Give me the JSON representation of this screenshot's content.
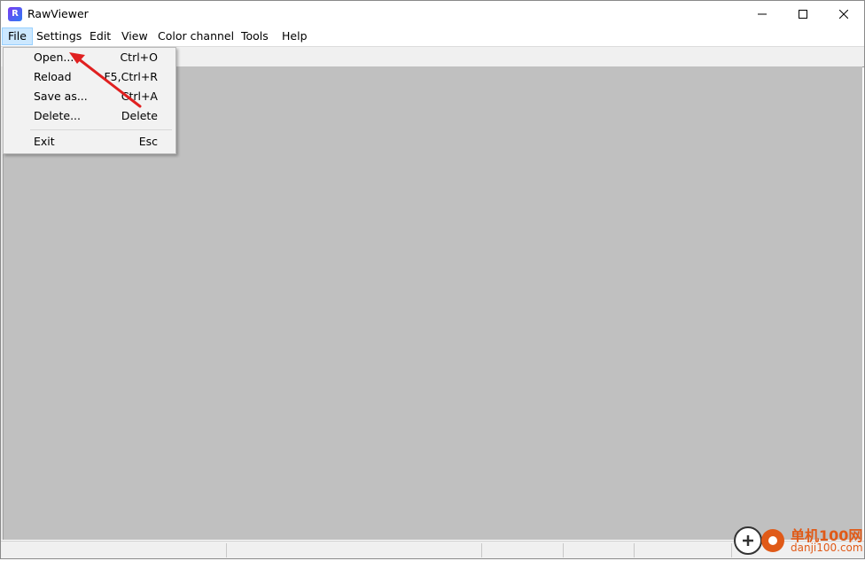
{
  "window": {
    "title": "RawViewer",
    "controls": {
      "minimize": "minimize-icon",
      "maximize": "maximize-icon",
      "close": "close-icon"
    }
  },
  "menubar": {
    "items": [
      {
        "label": "File",
        "active": true
      },
      {
        "label": "Settings"
      },
      {
        "label": "Edit"
      },
      {
        "label": "View"
      },
      {
        "label": "Color channel"
      },
      {
        "label": "Tools"
      },
      {
        "label": "Help"
      }
    ]
  },
  "file_menu": {
    "items": [
      {
        "label": "Open...",
        "shortcut": "Ctrl+O"
      },
      {
        "label": "Reload",
        "shortcut": "F5,Ctrl+R"
      },
      {
        "label": "Save as...",
        "shortcut": "Ctrl+A"
      },
      {
        "label": "Delete...",
        "shortcut": "Delete"
      },
      {
        "label": "Exit",
        "shortcut": "Esc"
      }
    ]
  },
  "annotation": {
    "arrow_color": "#e02020"
  },
  "watermark": {
    "cn": "单机100网",
    "en": "danji100.com",
    "color": "#e05a18"
  },
  "colors": {
    "canvas": "#c0c0c0",
    "menu_highlight": "#cce8ff"
  }
}
